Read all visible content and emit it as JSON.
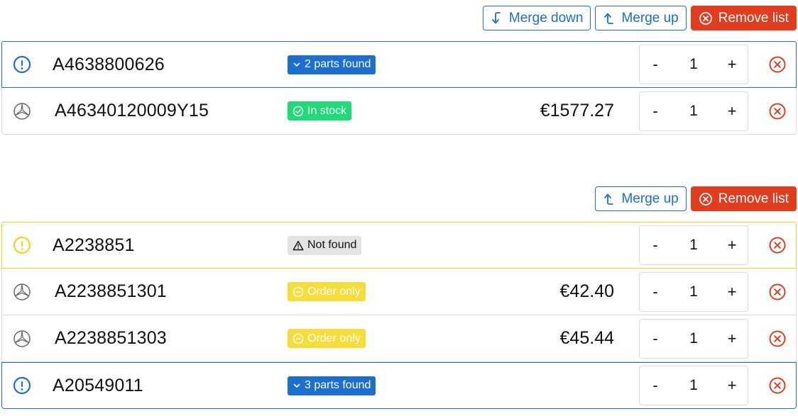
{
  "colors": {
    "accent": "#1a6fd1",
    "danger": "#e23d1f",
    "in_stock": "#1fdc78",
    "order_only": "#f7dd3a",
    "not_found_bg": "#e4e4e4",
    "warning_border": "#f2d21c"
  },
  "lists": [
    {
      "toolbar": {
        "merge_down_label": "Merge down",
        "merge_up_label": "Merge up",
        "remove_list_label": "Remove list"
      },
      "rows": [
        {
          "icon": "info-circle-icon",
          "part_no": "A4638800626",
          "badge": "2 parts found",
          "badge_icon": "chevron-down-icon",
          "price": "",
          "qty": "1"
        },
        {
          "icon": "mercedes-star-icon",
          "part_no": "A46340120009Y15",
          "badge": "In stock",
          "badge_icon": "check-circle-icon",
          "price": "€1577.27",
          "qty": "1"
        }
      ]
    },
    {
      "toolbar": {
        "merge_up_label": "Merge up",
        "remove_list_label": "Remove list"
      },
      "rows": [
        {
          "icon": "warning-circle-icon",
          "part_no": "A2238851",
          "badge": "Not found",
          "badge_icon": "warning-triangle-icon",
          "price": "",
          "qty": "1"
        },
        {
          "icon": "mercedes-star-icon",
          "part_no": "A2238851301",
          "badge": "Order only",
          "badge_icon": "minus-circle-icon",
          "price": "€42.40",
          "qty": "1"
        },
        {
          "icon": "mercedes-star-icon",
          "part_no": "A2238851303",
          "badge": "Order only",
          "badge_icon": "minus-circle-icon",
          "price": "€45.44",
          "qty": "1"
        },
        {
          "icon": "info-circle-icon",
          "part_no": "A20549011",
          "badge": "3 parts found",
          "badge_icon": "chevron-down-icon",
          "price": "",
          "qty": "1"
        }
      ]
    }
  ],
  "stepper": {
    "minus": "-",
    "plus": "+"
  }
}
